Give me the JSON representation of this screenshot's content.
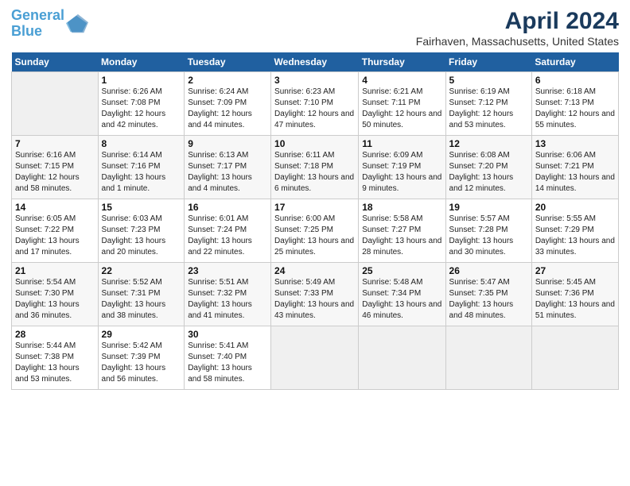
{
  "header": {
    "logo_line1": "General",
    "logo_line2": "Blue",
    "month": "April 2024",
    "location": "Fairhaven, Massachusetts, United States"
  },
  "weekdays": [
    "Sunday",
    "Monday",
    "Tuesday",
    "Wednesday",
    "Thursday",
    "Friday",
    "Saturday"
  ],
  "weeks": [
    [
      {
        "day": "",
        "empty": true
      },
      {
        "day": "1",
        "sunrise": "6:26 AM",
        "sunset": "7:08 PM",
        "daylight": "12 hours and 42 minutes."
      },
      {
        "day": "2",
        "sunrise": "6:24 AM",
        "sunset": "7:09 PM",
        "daylight": "12 hours and 44 minutes."
      },
      {
        "day": "3",
        "sunrise": "6:23 AM",
        "sunset": "7:10 PM",
        "daylight": "12 hours and 47 minutes."
      },
      {
        "day": "4",
        "sunrise": "6:21 AM",
        "sunset": "7:11 PM",
        "daylight": "12 hours and 50 minutes."
      },
      {
        "day": "5",
        "sunrise": "6:19 AM",
        "sunset": "7:12 PM",
        "daylight": "12 hours and 53 minutes."
      },
      {
        "day": "6",
        "sunrise": "6:18 AM",
        "sunset": "7:13 PM",
        "daylight": "12 hours and 55 minutes."
      }
    ],
    [
      {
        "day": "7",
        "sunrise": "6:16 AM",
        "sunset": "7:15 PM",
        "daylight": "12 hours and 58 minutes."
      },
      {
        "day": "8",
        "sunrise": "6:14 AM",
        "sunset": "7:16 PM",
        "daylight": "13 hours and 1 minute."
      },
      {
        "day": "9",
        "sunrise": "6:13 AM",
        "sunset": "7:17 PM",
        "daylight": "13 hours and 4 minutes."
      },
      {
        "day": "10",
        "sunrise": "6:11 AM",
        "sunset": "7:18 PM",
        "daylight": "13 hours and 6 minutes."
      },
      {
        "day": "11",
        "sunrise": "6:09 AM",
        "sunset": "7:19 PM",
        "daylight": "13 hours and 9 minutes."
      },
      {
        "day": "12",
        "sunrise": "6:08 AM",
        "sunset": "7:20 PM",
        "daylight": "13 hours and 12 minutes."
      },
      {
        "day": "13",
        "sunrise": "6:06 AM",
        "sunset": "7:21 PM",
        "daylight": "13 hours and 14 minutes."
      }
    ],
    [
      {
        "day": "14",
        "sunrise": "6:05 AM",
        "sunset": "7:22 PM",
        "daylight": "13 hours and 17 minutes."
      },
      {
        "day": "15",
        "sunrise": "6:03 AM",
        "sunset": "7:23 PM",
        "daylight": "13 hours and 20 minutes."
      },
      {
        "day": "16",
        "sunrise": "6:01 AM",
        "sunset": "7:24 PM",
        "daylight": "13 hours and 22 minutes."
      },
      {
        "day": "17",
        "sunrise": "6:00 AM",
        "sunset": "7:25 PM",
        "daylight": "13 hours and 25 minutes."
      },
      {
        "day": "18",
        "sunrise": "5:58 AM",
        "sunset": "7:27 PM",
        "daylight": "13 hours and 28 minutes."
      },
      {
        "day": "19",
        "sunrise": "5:57 AM",
        "sunset": "7:28 PM",
        "daylight": "13 hours and 30 minutes."
      },
      {
        "day": "20",
        "sunrise": "5:55 AM",
        "sunset": "7:29 PM",
        "daylight": "13 hours and 33 minutes."
      }
    ],
    [
      {
        "day": "21",
        "sunrise": "5:54 AM",
        "sunset": "7:30 PM",
        "daylight": "13 hours and 36 minutes."
      },
      {
        "day": "22",
        "sunrise": "5:52 AM",
        "sunset": "7:31 PM",
        "daylight": "13 hours and 38 minutes."
      },
      {
        "day": "23",
        "sunrise": "5:51 AM",
        "sunset": "7:32 PM",
        "daylight": "13 hours and 41 minutes."
      },
      {
        "day": "24",
        "sunrise": "5:49 AM",
        "sunset": "7:33 PM",
        "daylight": "13 hours and 43 minutes."
      },
      {
        "day": "25",
        "sunrise": "5:48 AM",
        "sunset": "7:34 PM",
        "daylight": "13 hours and 46 minutes."
      },
      {
        "day": "26",
        "sunrise": "5:47 AM",
        "sunset": "7:35 PM",
        "daylight": "13 hours and 48 minutes."
      },
      {
        "day": "27",
        "sunrise": "5:45 AM",
        "sunset": "7:36 PM",
        "daylight": "13 hours and 51 minutes."
      }
    ],
    [
      {
        "day": "28",
        "sunrise": "5:44 AM",
        "sunset": "7:38 PM",
        "daylight": "13 hours and 53 minutes."
      },
      {
        "day": "29",
        "sunrise": "5:42 AM",
        "sunset": "7:39 PM",
        "daylight": "13 hours and 56 minutes."
      },
      {
        "day": "30",
        "sunrise": "5:41 AM",
        "sunset": "7:40 PM",
        "daylight": "13 hours and 58 minutes."
      },
      {
        "day": "",
        "empty": true
      },
      {
        "day": "",
        "empty": true
      },
      {
        "day": "",
        "empty": true
      },
      {
        "day": "",
        "empty": true
      }
    ]
  ]
}
